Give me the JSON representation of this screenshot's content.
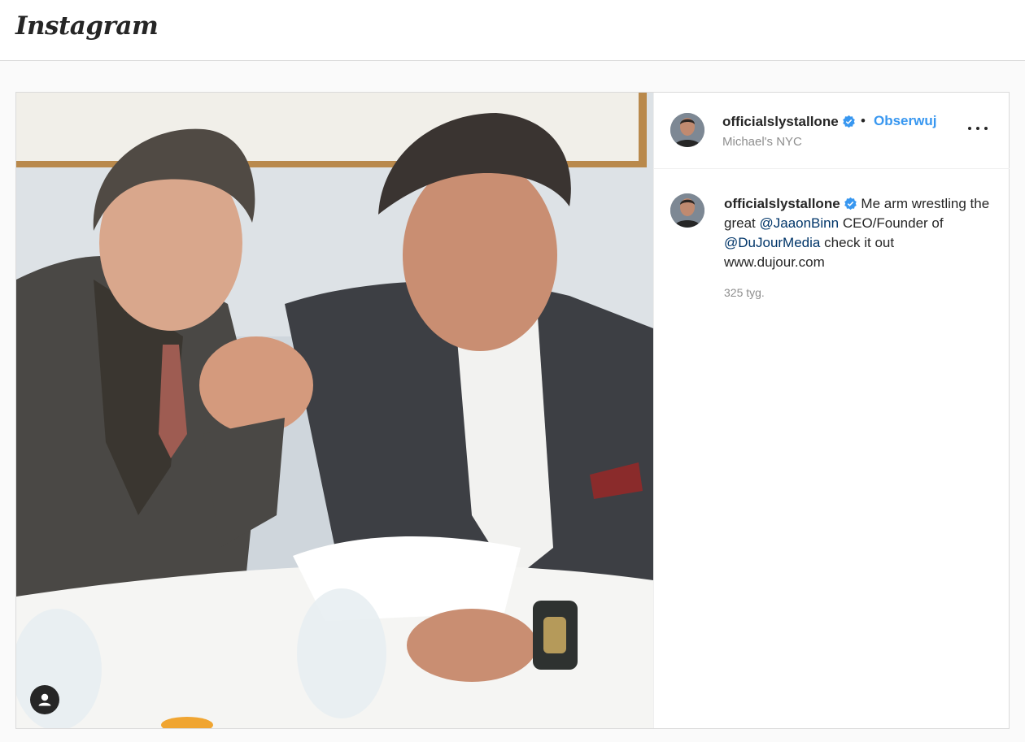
{
  "header": {
    "logo_text": "Instagram"
  },
  "post": {
    "image_alt": "Two men in suits arm wrestling at a restaurant table",
    "author": {
      "username": "officialslystallone",
      "verified": true,
      "location": "Michael's NYC"
    },
    "follow_label": "Obserwuj",
    "separator": "•",
    "more_icon": "more-horizontal-icon",
    "caption": {
      "username": "officialslystallone",
      "text_1": "Me arm wrestling the great",
      "mention_1": "@JaaonBinn",
      "text_2": "CEO/Founder of",
      "mention_2": "@DuJourMedia",
      "text_3": "check it out www.dujour.com"
    },
    "timestamp": "325 tyg."
  },
  "colors": {
    "link_blue": "#3897f0",
    "mention": "#003569",
    "muted": "#8e8e8e",
    "border": "#dbdbdb"
  }
}
